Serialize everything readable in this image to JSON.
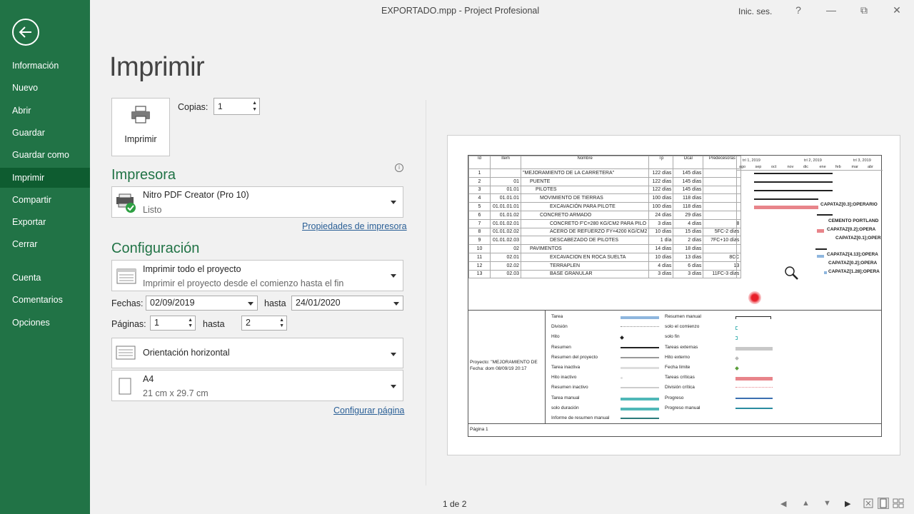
{
  "titlebar": {
    "title": "EXPORTADO.mpp  -  Project Profesional",
    "signin": "Inic. ses.",
    "help": "?",
    "minimize": "—",
    "restore": "⧉",
    "close": "✕"
  },
  "sidebar": {
    "items": [
      {
        "label": "Información"
      },
      {
        "label": "Nuevo"
      },
      {
        "label": "Abrir"
      },
      {
        "label": "Guardar"
      },
      {
        "label": "Guardar como"
      },
      {
        "label": "Imprimir",
        "active": true
      },
      {
        "label": "Compartir"
      },
      {
        "label": "Exportar"
      },
      {
        "label": "Cerrar"
      },
      {
        "label": "Cuenta"
      },
      {
        "label": "Comentarios"
      },
      {
        "label": "Opciones"
      }
    ]
  },
  "main": {
    "heading": "Imprimir",
    "print_button": "Imprimir",
    "copies_label": "Copias:",
    "copies_value": "1",
    "printer_section": "Impresora",
    "printer_name": "Nitro PDF Creator (Pro 10)",
    "printer_status": "Listo",
    "printer_props": "Propiedades de impresora",
    "config_section": "Configuración",
    "scope_main": "Imprimir todo el proyecto",
    "scope_sub": "Imprimir el proyecto desde el comienzo hasta el fin",
    "dates_label": "Fechas:",
    "date_from": "02/09/2019",
    "date_to_label": "hasta",
    "date_to": "24/01/2020",
    "pages_label": "Páginas:",
    "page_from": "1",
    "pages_to_label": "hasta",
    "page_to": "2",
    "orientation": "Orientación horizontal",
    "paper_main": "A4",
    "paper_sub": "21 cm x 29.7 cm",
    "page_setup": "Configurar página",
    "page_counter": "1 de 2",
    "info_glyph": "i"
  },
  "preview": {
    "columns": [
      "Id",
      "Item",
      "Nombre",
      "Tp",
      "Dcal",
      "Predecesoras"
    ],
    "rows": [
      {
        "id": "1",
        "item": "",
        "name": "\"MEJORAMIENTO DE LA CARRETERA\"",
        "tp": "122 días",
        "dcal": "145 días",
        "pred": "",
        "bold": true
      },
      {
        "id": "2",
        "item": "01",
        "name": "PUENTE",
        "tp": "122 días",
        "dcal": "145 días",
        "pred": "",
        "bold": true
      },
      {
        "id": "3",
        "item": "01.01",
        "name": "PILOTES",
        "tp": "122 días",
        "dcal": "145 días",
        "pred": "",
        "bold": true
      },
      {
        "id": "4",
        "item": "01.01.01",
        "name": "MOVIMIENTO DE TIERRAS",
        "tp": "100 días",
        "dcal": "118 días",
        "pred": "",
        "bold": true
      },
      {
        "id": "5",
        "item": "01.01.01.01",
        "name": "EXCAVACIÓN PARA PILOTE",
        "tp": "100 días",
        "dcal": "118 días",
        "pred": "",
        "bold": false
      },
      {
        "id": "6",
        "item": "01.01.02",
        "name": "CONCRETO ARMADO",
        "tp": "24 días",
        "dcal": "29 días",
        "pred": "",
        "bold": true
      },
      {
        "id": "7",
        "item": "01.01.02.01",
        "name": "CONCRETO F'C=280 KG/CM2 PARA PILO",
        "tp": "3 días",
        "dcal": "4 días",
        "pred": "8",
        "bold": false
      },
      {
        "id": "8",
        "item": "01.01.02.02",
        "name": "ACERO DE REFUERZO FY=4200 KG/CM2",
        "tp": "10 días",
        "dcal": "15 días",
        "pred": "5FC-2 días",
        "bold": false
      },
      {
        "id": "9",
        "item": "01.01.02.03",
        "name": "DESCABEZADO DE PILOTES",
        "tp": "1 día",
        "dcal": "2 días",
        "pred": "7FC+10 días",
        "bold": false
      },
      {
        "id": "10",
        "item": "02",
        "name": "PAVIMENTOS",
        "tp": "14 días",
        "dcal": "18 días",
        "pred": "",
        "bold": true
      },
      {
        "id": "11",
        "item": "02.01",
        "name": "EXCAVACION EN ROCA SUELTA",
        "tp": "10 días",
        "dcal": "13 días",
        "pred": "8CC",
        "bold": false
      },
      {
        "id": "12",
        "item": "02.02",
        "name": "TERRAPLEN",
        "tp": "4 días",
        "dcal": "6 días",
        "pred": "13",
        "bold": false
      },
      {
        "id": "13",
        "item": "02.03",
        "name": "BASE GRANULAR",
        "tp": "3 días",
        "dcal": "3 días",
        "pred": "11FC-3 días",
        "bold": false
      }
    ],
    "timeline_quarters": [
      "trí 1, 2019",
      "trí 2, 2019",
      "trí 3, 2019"
    ],
    "timeline_months": [
      "ago",
      "sep",
      "oct",
      "nov",
      "dic",
      "ene",
      "feb",
      "mar",
      "abr"
    ],
    "resource_labels": [
      "CAPATAZ[0.3];OPERARIO",
      "CEMENTO PORTLAND",
      "CAPATAZ[0.2];OPERA",
      "CAPATAZ[0.1];OPER",
      "CAPATAZ[4.13];OPERA",
      "CAPATAZ[0.2];OPERA",
      "CAPATAZ[1.28];OPERA"
    ],
    "project_info": [
      "Proyecto: \"MEJORAMIENTO DE",
      "Fecha: dom 08/09/19 20:17"
    ],
    "legend_left": [
      "Tarea",
      "División",
      "Hito",
      "Resumen",
      "Resumen del proyecto",
      "Tarea inactiva",
      "Hito inactivo",
      "Resumen inactivo",
      "Tarea manual",
      "solo duración",
      "Informe de resumen manual"
    ],
    "legend_right": [
      "Resumen manual",
      "solo el comienzo",
      "solo fin",
      "Tareas externas",
      "Hito externo",
      "Fecha límite",
      "Tareas críticas",
      "División crítica",
      "Progreso",
      "Progreso manual"
    ],
    "page_label": "Página 1"
  },
  "colors": {
    "accent": "#217346",
    "active_nav": "#0e5c30",
    "critical": "#e8848a",
    "task": "#8eb6de",
    "manual": "#4fb8b8"
  }
}
